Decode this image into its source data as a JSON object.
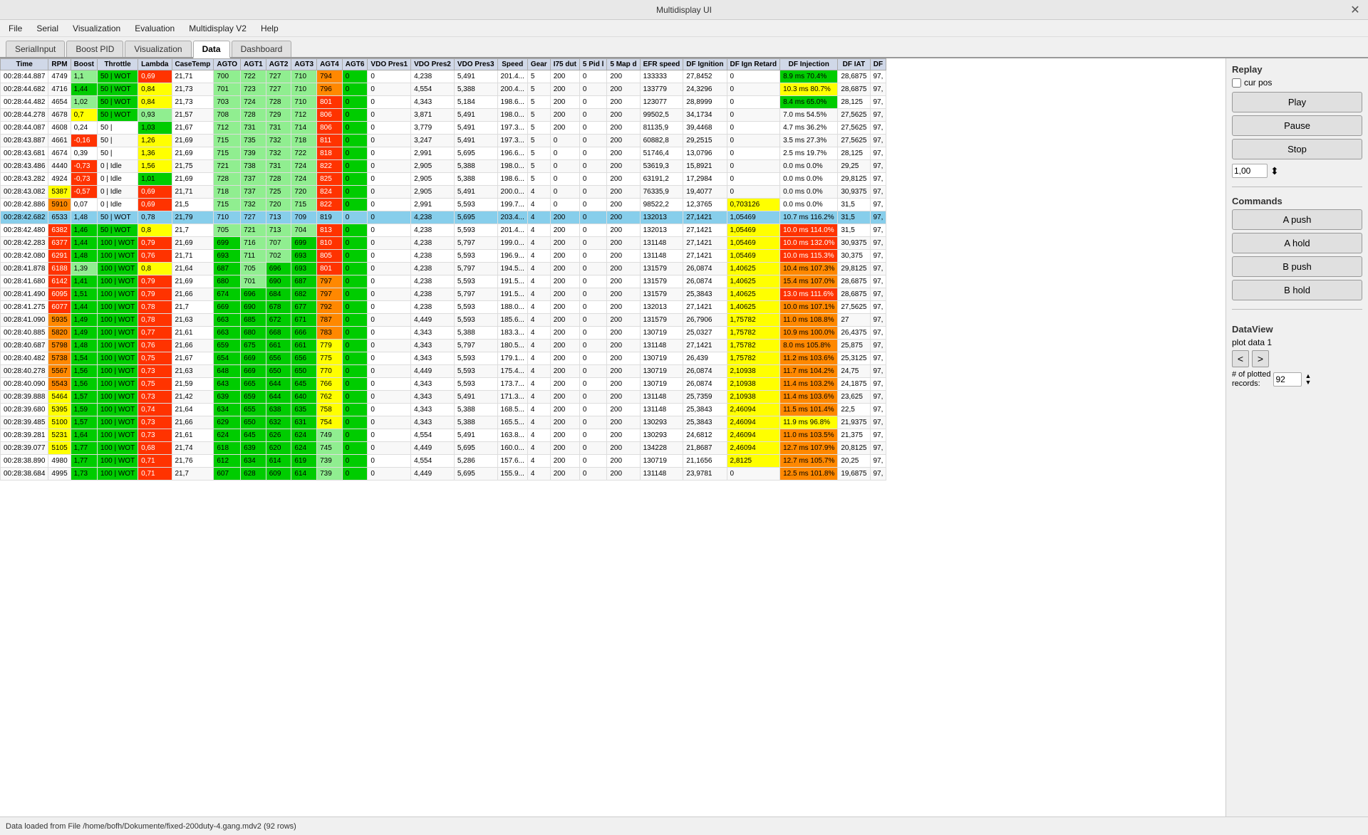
{
  "titlebar": {
    "title": "Multidisplay UI",
    "close_label": "✕"
  },
  "menubar": {
    "items": [
      "File",
      "Serial",
      "Visualization",
      "Evaluation",
      "Multidisplay V2",
      "Help"
    ]
  },
  "tabs": {
    "items": [
      "SerialInput",
      "Boost PID",
      "Visualization",
      "Data",
      "Dashboard"
    ],
    "active": "Data"
  },
  "replay": {
    "section_title": "Replay",
    "cur_pos_label": "cur pos",
    "play_label": "Play",
    "pause_label": "Pause",
    "stop_label": "Stop",
    "speed_value": "1,00"
  },
  "commands": {
    "section_title": "Commands",
    "a_push_label": "A push",
    "a_hold_label": "A hold",
    "b_push_label": "B push",
    "b_hold_label": "B hold"
  },
  "dataview": {
    "section_title": "DataView",
    "plot_data_label": "plot data 1",
    "prev_label": "<",
    "next_label": ">",
    "records_label": "# of plotted records:",
    "records_value": "92"
  },
  "table": {
    "columns": [
      "Time",
      "RPM",
      "Boost",
      "Throttle",
      "Lambda",
      "CaseTemp",
      "AGTO",
      "AGT1",
      "AGT2",
      "AGT3",
      "AGT4",
      "AGT6",
      "VDO Pres1",
      "VDO Pres2",
      "VDO Pres3",
      "Speed",
      "Gear",
      "I75 dut",
      "5 Pid l",
      "5 Map d",
      "EFR speed",
      "DF Ignition",
      "DF Ign Retard",
      "DF Injection",
      "DF IAT",
      "DF"
    ],
    "rows": [
      [
        "00:28:44.887",
        "4749",
        "1,1",
        "50 | WOT",
        "0,69",
        "21,71",
        "700",
        "722",
        "727",
        "710",
        "794",
        "0",
        "0",
        "4,238",
        "5,491",
        "201.4...",
        "5",
        "200",
        "0",
        "200",
        "133333",
        "27,8452",
        "0",
        "8.9 ms 70.4%",
        "28,6875",
        "97,"
      ],
      [
        "00:28:44.682",
        "4716",
        "1,44",
        "50 | WOT",
        "0,84",
        "21,73",
        "701",
        "723",
        "727",
        "710",
        "796",
        "0",
        "0",
        "4,554",
        "5,388",
        "200.4...",
        "5",
        "200",
        "0",
        "200",
        "133779",
        "24,3296",
        "0",
        "10.3 ms 80.7%",
        "28,6875",
        "97,"
      ],
      [
        "00:28:44.482",
        "4654",
        "1,02",
        "50 | WOT",
        "0,84",
        "21,73",
        "703",
        "724",
        "728",
        "710",
        "801",
        "0",
        "0",
        "4,343",
        "5,184",
        "198.6...",
        "5",
        "200",
        "0",
        "200",
        "123077",
        "28,8999",
        "0",
        "8.4 ms 65.0%",
        "28,125",
        "97,"
      ],
      [
        "00:28:44.278",
        "4678",
        "0,7",
        "50 | WOT",
        "0,93",
        "21,57",
        "708",
        "728",
        "729",
        "712",
        "806",
        "0",
        "0",
        "3,871",
        "5,491",
        "198.0...",
        "5",
        "200",
        "0",
        "200",
        "99502,5",
        "34,1734",
        "0",
        "7.0 ms 54.5%",
        "27,5625",
        "97,"
      ],
      [
        "00:28:44.087",
        "4608",
        "0,24",
        "50 |",
        "1,03",
        "21,67",
        "712",
        "731",
        "731",
        "714",
        "806",
        "0",
        "0",
        "3,779",
        "5,491",
        "197.3...",
        "5",
        "200",
        "0",
        "200",
        "81135,9",
        "39,4468",
        "0",
        "4.7 ms 36.2%",
        "27,5625",
        "97,"
      ],
      [
        "00:28:43.887",
        "4661",
        "-0,16",
        "50 |",
        "1,26",
        "21,69",
        "715",
        "735",
        "732",
        "718",
        "811",
        "0",
        "0",
        "3,247",
        "5,491",
        "197.3...",
        "5",
        "0",
        "0",
        "200",
        "60882,8",
        "29,2515",
        "0",
        "3.5 ms 27.3%",
        "27,5625",
        "97,"
      ],
      [
        "00:28:43.681",
        "4674",
        "0,39",
        "50 |",
        "1,36",
        "21,69",
        "715",
        "739",
        "732",
        "722",
        "818",
        "0",
        "0",
        "2,991",
        "5,695",
        "196.6...",
        "5",
        "0",
        "0",
        "200",
        "51746,4",
        "13,0796",
        "0",
        "2.5 ms 19.7%",
        "28,125",
        "97,"
      ],
      [
        "00:28:43.486",
        "4440",
        "-0,73",
        "0 | Idle",
        "1,56",
        "21,75",
        "721",
        "738",
        "731",
        "724",
        "822",
        "0",
        "0",
        "2,905",
        "5,388",
        "198.0...",
        "5",
        "0",
        "0",
        "200",
        "53619,3",
        "15,8921",
        "0",
        "0.0 ms 0.0%",
        "29,25",
        "97,"
      ],
      [
        "00:28:43.282",
        "4924",
        "-0,73",
        "0 | Idle",
        "1,01",
        "21,69",
        "728",
        "737",
        "728",
        "724",
        "825",
        "0",
        "0",
        "2,905",
        "5,388",
        "198.6...",
        "5",
        "0",
        "0",
        "200",
        "63191,2",
        "17,2984",
        "0",
        "0.0 ms 0.0%",
        "29,8125",
        "97,"
      ],
      [
        "00:28:43.082",
        "5387",
        "-0,57",
        "0 | Idle",
        "0,69",
        "21,71",
        "718",
        "737",
        "725",
        "720",
        "824",
        "0",
        "0",
        "2,905",
        "5,491",
        "200.0...",
        "4",
        "0",
        "0",
        "200",
        "76335,9",
        "19,4077",
        "0",
        "0.0 ms 0.0%",
        "30,9375",
        "97,"
      ],
      [
        "00:28:42.886",
        "5910",
        "0,07",
        "0 | Idle",
        "0,69",
        "21,5",
        "715",
        "732",
        "720",
        "715",
        "822",
        "0",
        "0",
        "2,991",
        "5,593",
        "199.7...",
        "4",
        "0",
        "0",
        "200",
        "98522,2",
        "12,3765",
        "0,703126",
        "0.0 ms 0.0%",
        "31,5",
        "97,"
      ],
      [
        "00:28:42.682",
        "6533",
        "1,48",
        "50 | WOT",
        "0,78",
        "21,79",
        "710",
        "727",
        "713",
        "709",
        "819",
        "0",
        "0",
        "4,238",
        "5,695",
        "203.4...",
        "4",
        "200",
        "0",
        "200",
        "132013",
        "27,1421",
        "1,05469",
        "10.7 ms 116.2%",
        "31,5",
        "97,"
      ],
      [
        "00:28:42.480",
        "6382",
        "1,46",
        "50 | WOT",
        "0,8",
        "21,7",
        "705",
        "721",
        "713",
        "704",
        "813",
        "0",
        "0",
        "4,238",
        "5,593",
        "201.4...",
        "4",
        "200",
        "0",
        "200",
        "132013",
        "27,1421",
        "1,05469",
        "10.0 ms 114.0%",
        "31,5",
        "97,"
      ],
      [
        "00:28:42.283",
        "6377",
        "1,44",
        "100 | WOT",
        "0,79",
        "21,69",
        "699",
        "716",
        "707",
        "699",
        "810",
        "0",
        "0",
        "4,238",
        "5,797",
        "199.0...",
        "4",
        "200",
        "0",
        "200",
        "131148",
        "27,1421",
        "1,05469",
        "10.0 ms 132.0%",
        "30,9375",
        "97,"
      ],
      [
        "00:28:42.080",
        "6291",
        "1,48",
        "100 | WOT",
        "0,76",
        "21,71",
        "693",
        "711",
        "702",
        "693",
        "805",
        "0",
        "0",
        "4,238",
        "5,593",
        "196.9...",
        "4",
        "200",
        "0",
        "200",
        "131148",
        "27,1421",
        "1,05469",
        "10.0 ms 115.3%",
        "30,375",
        "97,"
      ],
      [
        "00:28:41.878",
        "6188",
        "1,39",
        "100 | WOT",
        "0,8",
        "21,64",
        "687",
        "705",
        "696",
        "693",
        "801",
        "0",
        "0",
        "4,238",
        "5,797",
        "194.5...",
        "4",
        "200",
        "0",
        "200",
        "131579",
        "26,0874",
        "1,40625",
        "10.4 ms 107.3%",
        "29,8125",
        "97,"
      ],
      [
        "00:28:41.680",
        "6142",
        "1,41",
        "100 | WOT",
        "0,79",
        "21,69",
        "680",
        "701",
        "690",
        "687",
        "797",
        "0",
        "0",
        "4,238",
        "5,593",
        "191.5...",
        "4",
        "200",
        "0",
        "200",
        "131579",
        "26,0874",
        "1,40625",
        "15.4 ms 107.0%",
        "28,6875",
        "97,"
      ],
      [
        "00:28:41.490",
        "6095",
        "1,51",
        "100 | WOT",
        "0,79",
        "21,66",
        "674",
        "696",
        "684",
        "682",
        "797",
        "0",
        "0",
        "4,238",
        "5,797",
        "191.5...",
        "4",
        "200",
        "0",
        "200",
        "131579",
        "25,3843",
        "1,40625",
        "13.0 ms 111.6%",
        "28,6875",
        "97,"
      ],
      [
        "00:28:41.275",
        "6077",
        "1,44",
        "100 | WOT",
        "0,78",
        "21,7",
        "669",
        "690",
        "678",
        "677",
        "792",
        "0",
        "0",
        "4,238",
        "5,593",
        "188.0...",
        "4",
        "200",
        "0",
        "200",
        "132013",
        "27,1421",
        "1,40625",
        "10.0 ms 107.1%",
        "27,5625",
        "97,"
      ],
      [
        "00:28:41.090",
        "5935",
        "1,49",
        "100 | WOT",
        "0,78",
        "21,63",
        "663",
        "685",
        "672",
        "671",
        "787",
        "0",
        "0",
        "4,449",
        "5,593",
        "185.6...",
        "4",
        "200",
        "0",
        "200",
        "131579",
        "26,7906",
        "1,75782",
        "11.0 ms 108.8%",
        "27",
        "97,"
      ],
      [
        "00:28:40.885",
        "5820",
        "1,49",
        "100 | WOT",
        "0,77",
        "21,61",
        "663",
        "680",
        "668",
        "666",
        "783",
        "0",
        "0",
        "4,343",
        "5,388",
        "183.3...",
        "4",
        "200",
        "0",
        "200",
        "130719",
        "25,0327",
        "1,75782",
        "10.9 ms 100.0%",
        "26,4375",
        "97,"
      ],
      [
        "00:28:40.687",
        "5798",
        "1,48",
        "100 | WOT",
        "0,76",
        "21,66",
        "659",
        "675",
        "661",
        "661",
        "779",
        "0",
        "0",
        "4,343",
        "5,797",
        "180.5...",
        "4",
        "200",
        "0",
        "200",
        "131148",
        "27,1421",
        "1,75782",
        "8.0 ms 105.8%",
        "25,875",
        "97,"
      ],
      [
        "00:28:40.482",
        "5738",
        "1,54",
        "100 | WOT",
        "0,75",
        "21,67",
        "654",
        "669",
        "656",
        "656",
        "775",
        "0",
        "0",
        "4,343",
        "5,593",
        "179.1...",
        "4",
        "200",
        "0",
        "200",
        "130719",
        "26,439",
        "1,75782",
        "11.2 ms 103.6%",
        "25,3125",
        "97,"
      ],
      [
        "00:28:40.278",
        "5567",
        "1,56",
        "100 | WOT",
        "0,73",
        "21,63",
        "648",
        "669",
        "650",
        "650",
        "770",
        "0",
        "0",
        "4,449",
        "5,593",
        "175.4...",
        "4",
        "200",
        "0",
        "200",
        "130719",
        "26,0874",
        "2,10938",
        "11.7 ms 104.2%",
        "24,75",
        "97,"
      ],
      [
        "00:28:40.090",
        "5543",
        "1,56",
        "100 | WOT",
        "0,75",
        "21,59",
        "643",
        "665",
        "644",
        "645",
        "766",
        "0",
        "0",
        "4,343",
        "5,593",
        "173.7...",
        "4",
        "200",
        "0",
        "200",
        "130719",
        "26,0874",
        "2,10938",
        "11.4 ms 103.2%",
        "24,1875",
        "97,"
      ],
      [
        "00:28:39.888",
        "5464",
        "1,57",
        "100 | WOT",
        "0,73",
        "21,42",
        "639",
        "659",
        "644",
        "640",
        "762",
        "0",
        "0",
        "4,343",
        "5,491",
        "171.3...",
        "4",
        "200",
        "0",
        "200",
        "131148",
        "25,7359",
        "2,10938",
        "11.4 ms 103.6%",
        "23,625",
        "97,"
      ],
      [
        "00:28:39.680",
        "5395",
        "1,59",
        "100 | WOT",
        "0,74",
        "21,64",
        "634",
        "655",
        "638",
        "635",
        "758",
        "0",
        "0",
        "4,343",
        "5,388",
        "168.5...",
        "4",
        "200",
        "0",
        "200",
        "131148",
        "25,3843",
        "2,46094",
        "11.5 ms 101.4%",
        "22,5",
        "97,"
      ],
      [
        "00:28:39.485",
        "5100",
        "1,57",
        "100 | WOT",
        "0,73",
        "21,66",
        "629",
        "650",
        "632",
        "631",
        "754",
        "0",
        "0",
        "4,343",
        "5,388",
        "165.5...",
        "4",
        "200",
        "0",
        "200",
        "130293",
        "25,3843",
        "2,46094",
        "11.9 ms 96.8%",
        "21,9375",
        "97,"
      ],
      [
        "00:28:39.281",
        "5231",
        "1,64",
        "100 | WOT",
        "0,73",
        "21,61",
        "624",
        "645",
        "626",
        "624",
        "749",
        "0",
        "0",
        "4,554",
        "5,491",
        "163.8...",
        "4",
        "200",
        "0",
        "200",
        "130293",
        "24,6812",
        "2,46094",
        "11.0 ms 103.5%",
        "21,375",
        "97,"
      ],
      [
        "00:28:39.077",
        "5105",
        "1,77",
        "100 | WOT",
        "0,68",
        "21,74",
        "618",
        "639",
        "620",
        "624",
        "745",
        "0",
        "0",
        "4,449",
        "5,695",
        "160.0...",
        "4",
        "200",
        "0",
        "200",
        "134228",
        "21,8687",
        "2,46094",
        "12.7 ms 107.9%",
        "20,8125",
        "97,"
      ],
      [
        "00:28:38.890",
        "4980",
        "1,77",
        "100 | WOT",
        "0,71",
        "21,76",
        "612",
        "634",
        "614",
        "619",
        "739",
        "0",
        "0",
        "4,554",
        "5,286",
        "157.6...",
        "4",
        "200",
        "0",
        "200",
        "130719",
        "21,1656",
        "2,8125",
        "12.7 ms 105.7%",
        "20,25",
        "97,"
      ],
      [
        "00:28:38.684",
        "4995",
        "1,73",
        "100 | WOT",
        "0,71",
        "21,7",
        "607",
        "628",
        "609",
        "614",
        "739",
        "0",
        "0",
        "4,449",
        "5,695",
        "155.9...",
        "4",
        "200",
        "0",
        "200",
        "131148",
        "23,9781",
        "0",
        "12.5 ms 101.8%",
        "19,6875",
        "97,"
      ]
    ]
  },
  "statusbar": {
    "text": "Data loaded from File /home/bofh/Dokumente/fixed-200duty-4.gang.mdv2 (92 rows)"
  }
}
